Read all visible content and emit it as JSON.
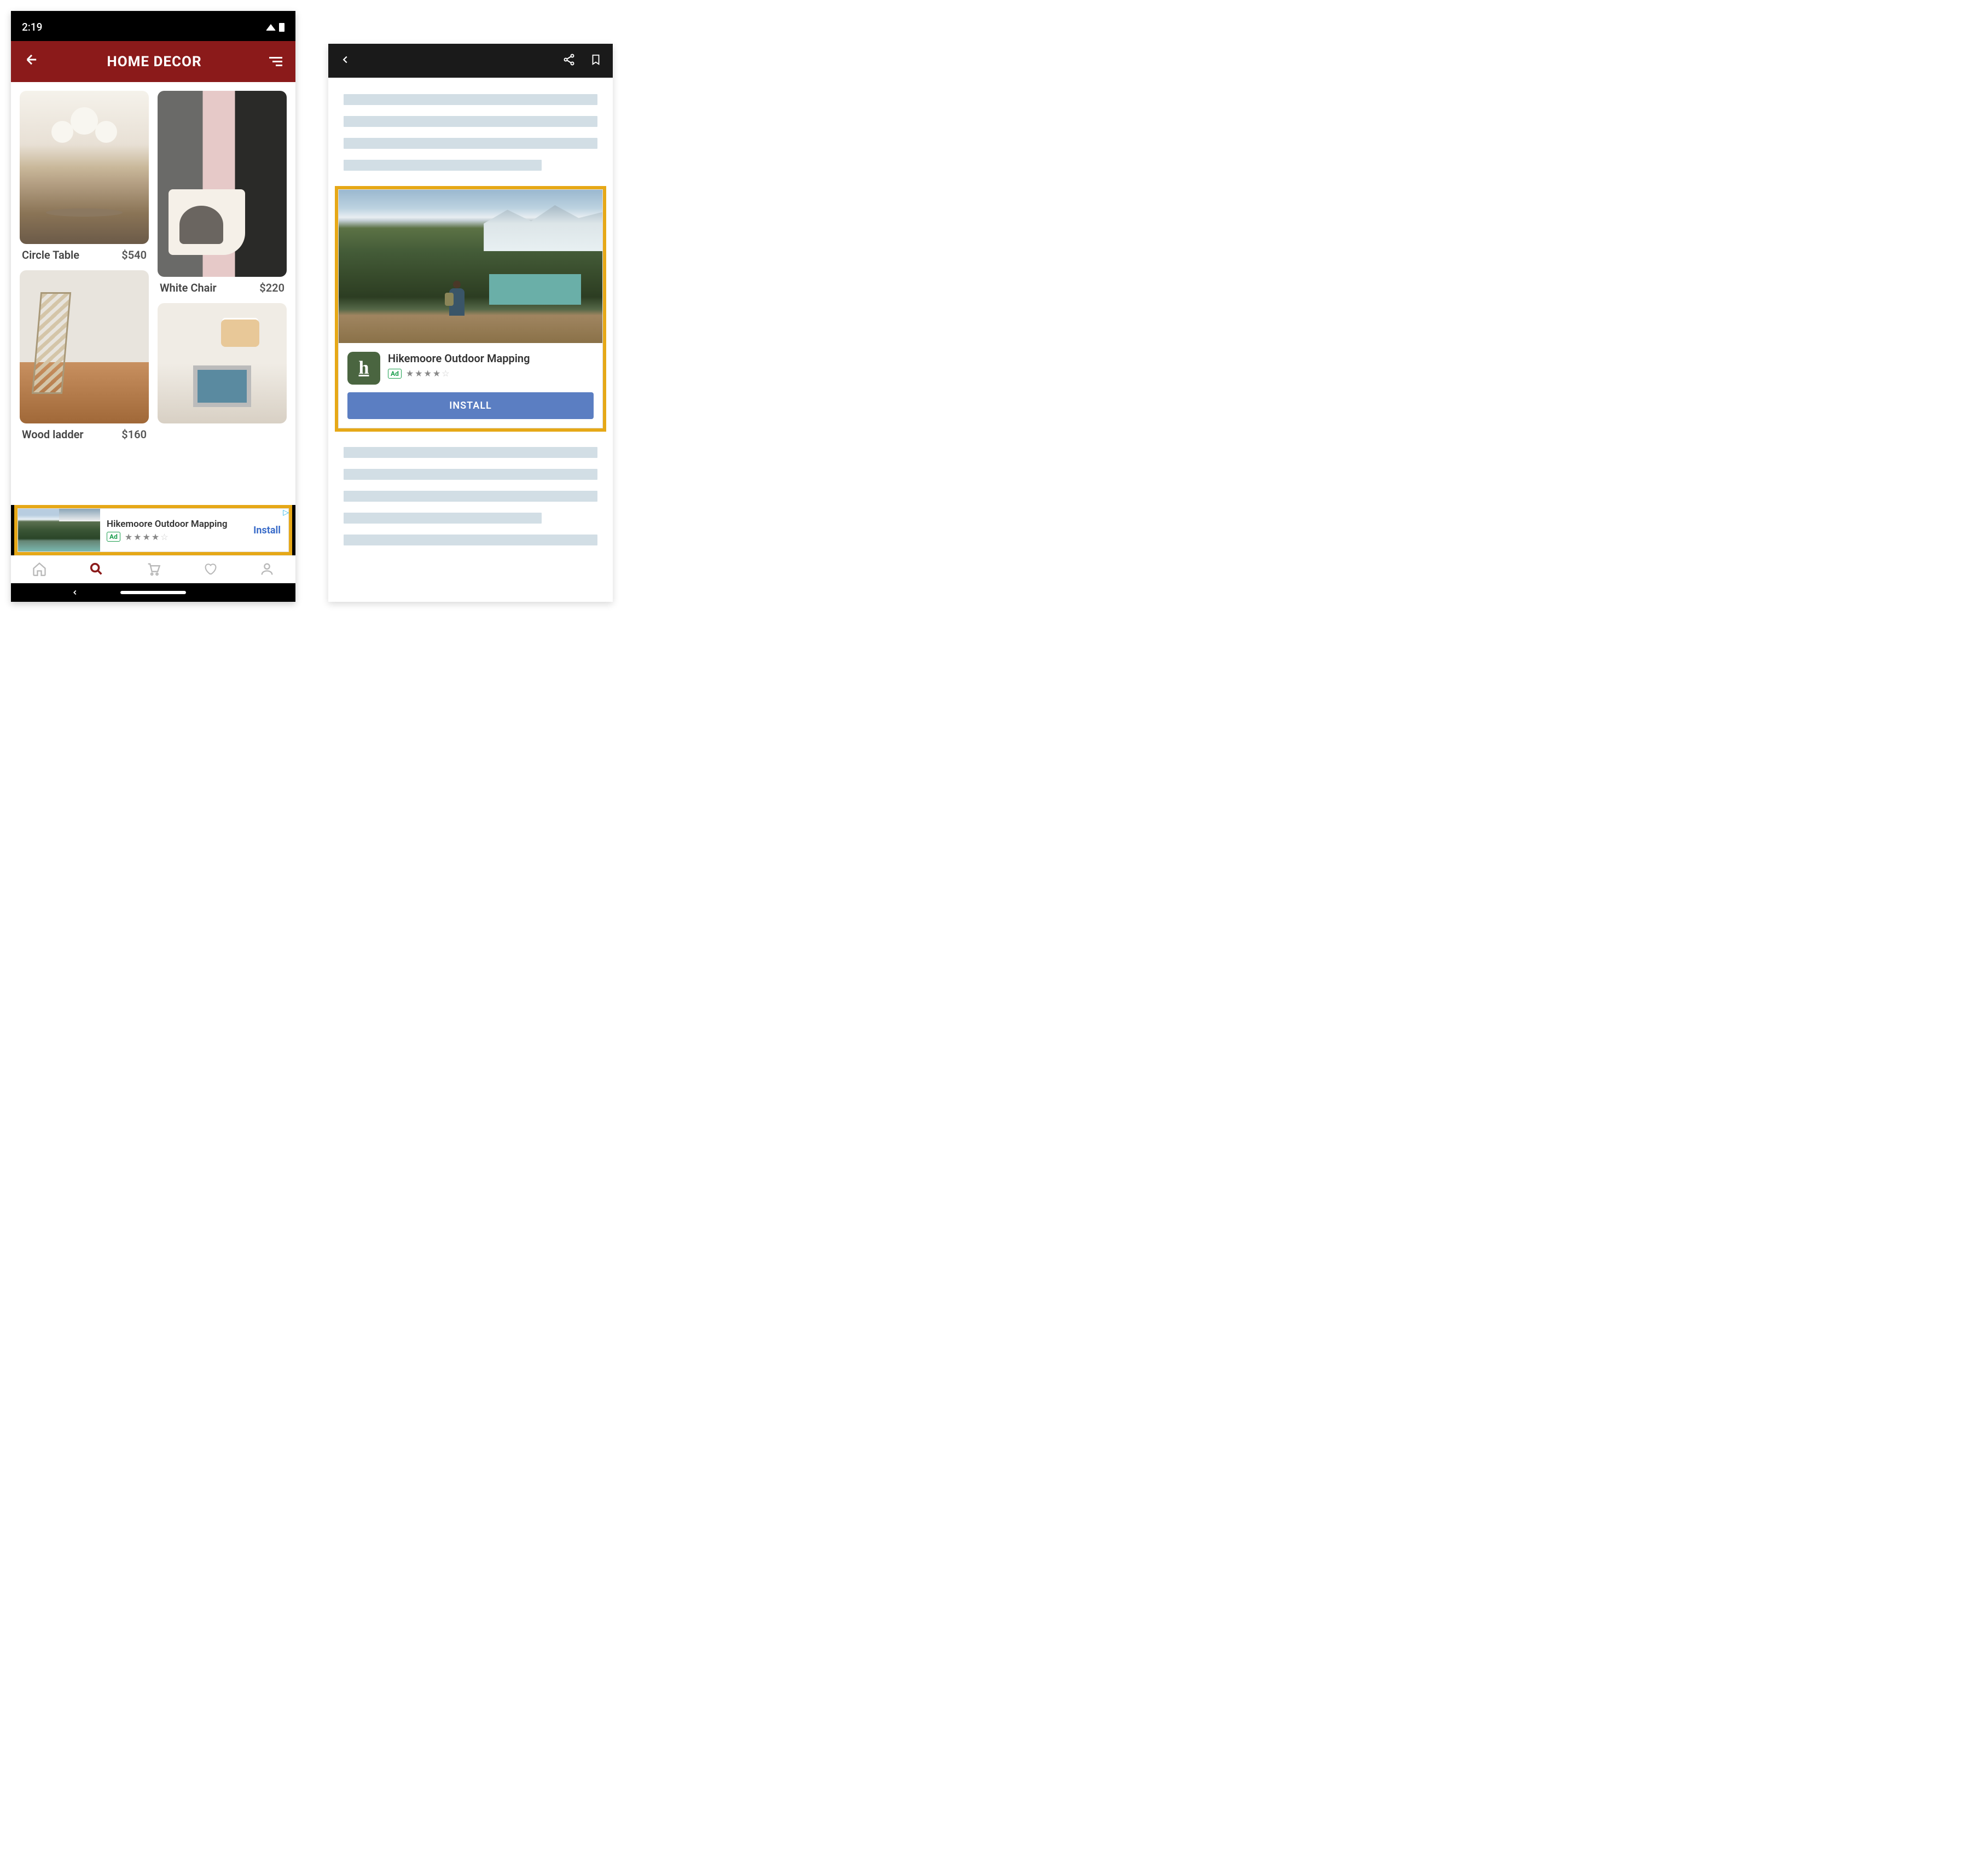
{
  "phone1": {
    "statusTime": "2:19",
    "headerTitle": "HOME DECOR",
    "products": [
      {
        "name": "Circle Table",
        "price": "$540"
      },
      {
        "name": "White Chair",
        "price": "$220"
      },
      {
        "name": "Wood ladder",
        "price": "$160"
      }
    ],
    "bannerAd": {
      "title": "Hikemoore Outdoor Mapping",
      "badge": "Ad",
      "rating": 4,
      "cta": "Install"
    }
  },
  "phone2": {
    "inlineAd": {
      "title": "Hikemoore Outdoor Mapping",
      "badge": "Ad",
      "rating": 4,
      "cta": "INSTALL",
      "iconLetter": "h"
    }
  }
}
